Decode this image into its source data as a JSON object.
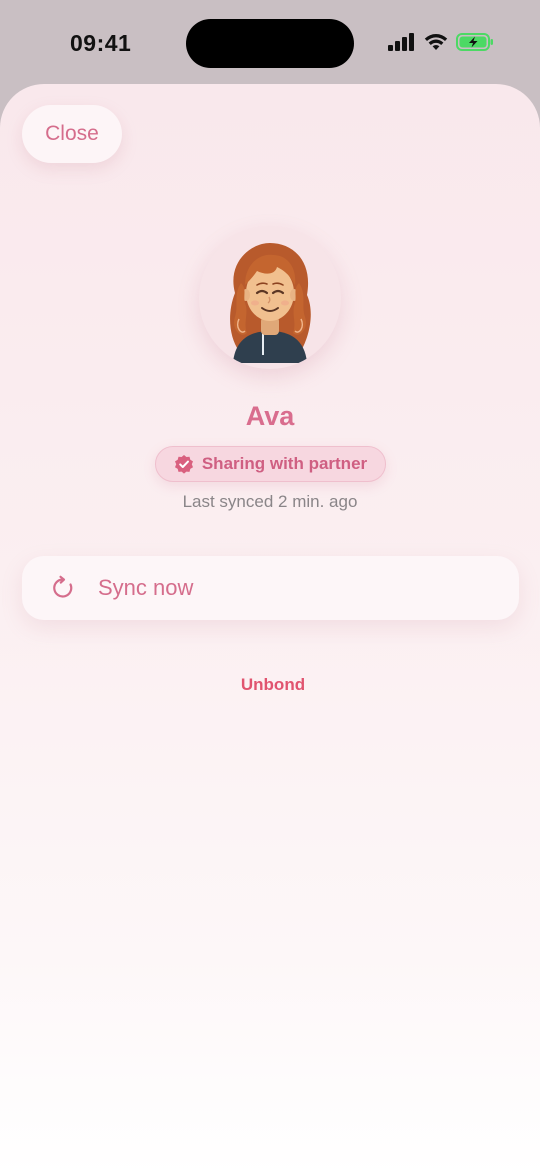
{
  "status_bar": {
    "time": "09:41",
    "icons": [
      "cellular-signal-icon",
      "wifi-icon",
      "battery-charging-icon"
    ]
  },
  "sheet": {
    "close_label": "Close"
  },
  "profile": {
    "name": "Ava",
    "avatar": "avatar-illustration",
    "sharing_badge": {
      "label": "Sharing with partner",
      "icon": "verified-check-icon"
    },
    "last_synced": "Last synced 2 min. ago"
  },
  "actions": {
    "sync_label": "Sync now",
    "sync_icon": "refresh-icon",
    "unbond_label": "Unbond"
  },
  "colors": {
    "accent": "#d56d8c",
    "danger": "#e1546f",
    "badge_bg": "#f7d7e0",
    "battery": "#4cd964"
  }
}
